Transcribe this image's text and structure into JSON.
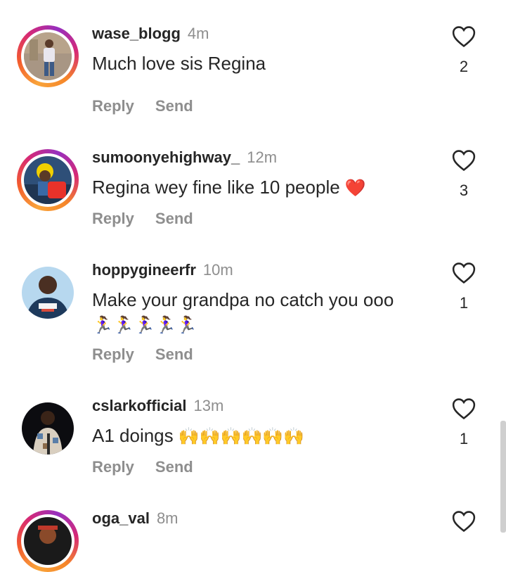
{
  "comments": [
    {
      "username": "wase_blogg",
      "time": "4m",
      "text": "Much love sis Regina",
      "likes": "2",
      "reply": "Reply",
      "send": "Send"
    },
    {
      "username": "sumoonyehighway_",
      "time": "12m",
      "text": "Regina wey fine like 10 people",
      "emoji": "❤️",
      "likes": "3",
      "reply": "Reply",
      "send": "Send"
    },
    {
      "username": "hoppygineerfr",
      "time": "10m",
      "text": "Make your grandpa no catch you ooo",
      "emoji_line": "🏃‍♀️🏃‍♀️🏃‍♀️🏃‍♀️🏃‍♀️",
      "likes": "1",
      "reply": "Reply",
      "send": "Send"
    },
    {
      "username": "cslarkofficial",
      "time": "13m",
      "text": "A1 doings",
      "emoji": "🙌🙌🙌🙌🙌🙌",
      "likes": "1",
      "reply": "Reply",
      "send": "Send"
    },
    {
      "username": "oga_val",
      "time": "8m"
    }
  ],
  "icons": {
    "like": "heart-outline-icon"
  },
  "colors": {
    "story_ring_start": "#f9a43a",
    "story_ring_end": "#d62976",
    "muted_text": "#8e8e8e",
    "text": "#262626"
  }
}
